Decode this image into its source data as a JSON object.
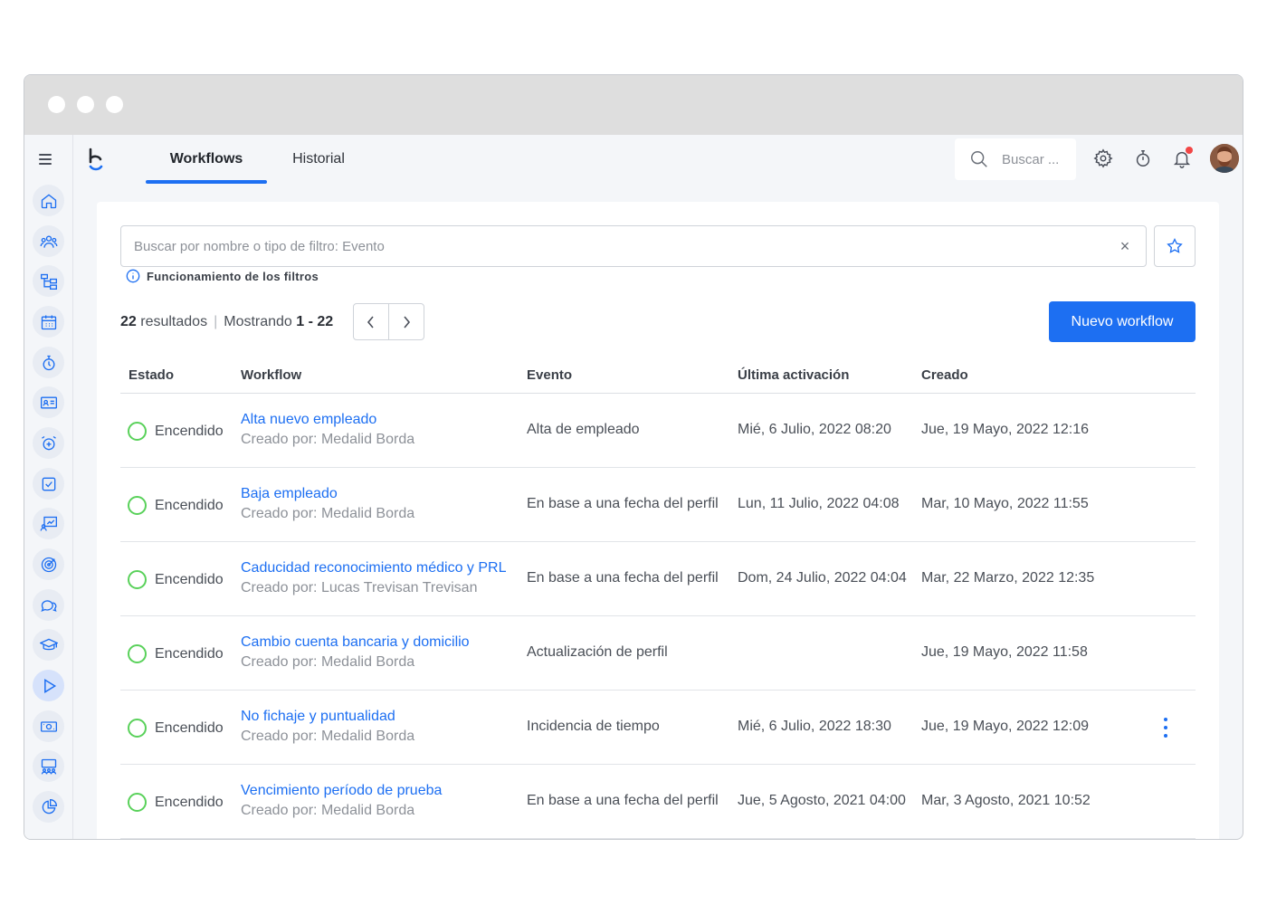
{
  "header": {
    "tabs": [
      {
        "label": "Workflows",
        "active": true
      },
      {
        "label": "Historial",
        "active": false
      }
    ],
    "search_placeholder": "Buscar ..."
  },
  "filter": {
    "placeholder": "Buscar por nombre o tipo de filtro: Evento",
    "clear_symbol": "×",
    "help_label": "Funcionamiento de los filtros"
  },
  "summary": {
    "count": "22",
    "count_label": "resultados",
    "separator": "|",
    "showing_label": "Mostrando",
    "range": "1 - 22"
  },
  "actions": {
    "new_label": "Nuevo workflow"
  },
  "table": {
    "columns": [
      "Estado",
      "Workflow",
      "Evento",
      "Última activación",
      "Creado"
    ],
    "rows": [
      {
        "status": "Encendido",
        "name": "Alta nuevo empleado",
        "author": "Creado por: Medalid Borda",
        "event": "Alta de empleado",
        "last": "Mié, 6 Julio, 2022 08:20",
        "created": "Jue, 19 Mayo, 2022 12:16"
      },
      {
        "status": "Encendido",
        "name": "Baja empleado",
        "author": "Creado por: Medalid Borda",
        "event": "En base a una fecha del perfil",
        "last": "Lun, 11 Julio, 2022 04:08",
        "created": "Mar, 10 Mayo, 2022 11:55"
      },
      {
        "status": "Encendido",
        "name": "Caducidad reconocimiento médico y PRL",
        "author": "Creado por: Lucas Trevisan Trevisan",
        "event": "En base a una fecha del perfil",
        "last": "Dom, 24 Julio, 2022 04:04",
        "created": "Mar, 22 Marzo, 2022 12:35"
      },
      {
        "status": "Encendido",
        "name": "Cambio cuenta bancaria y domicilio",
        "author": "Creado por: Medalid Borda",
        "event": "Actualización de perfil",
        "last": "",
        "created": "Jue, 19 Mayo, 2022 11:58"
      },
      {
        "status": "Encendido",
        "name": "No fichaje y puntualidad",
        "author": "Creado por: Medalid Borda",
        "event": "Incidencia de tiempo",
        "last": "Mié, 6 Julio, 2022 18:30",
        "created": "Jue, 19 Mayo, 2022 12:09"
      },
      {
        "status": "Encendido",
        "name": "Vencimiento período de prueba",
        "author": "Creado por: Medalid Borda",
        "event": "En base a una fecha del perfil",
        "last": "Jue, 5 Agosto, 2021 04:00",
        "created": "Mar, 3 Agosto, 2021 10:52"
      }
    ]
  },
  "sidebar_icons": [
    "home-icon",
    "people-icon",
    "org-chart-icon",
    "calendar-icon",
    "stopwatch-icon",
    "id-card-icon",
    "alarm-plus-icon",
    "checkbox-icon",
    "presentation-icon",
    "target-icon",
    "chat-icon",
    "graduation-cap-icon",
    "play-icon",
    "money-icon",
    "meeting-icon",
    "pie-chart-icon"
  ],
  "colors": {
    "accent": "#1d6ff2",
    "status_on": "#59d15a",
    "notification": "#f24646"
  }
}
